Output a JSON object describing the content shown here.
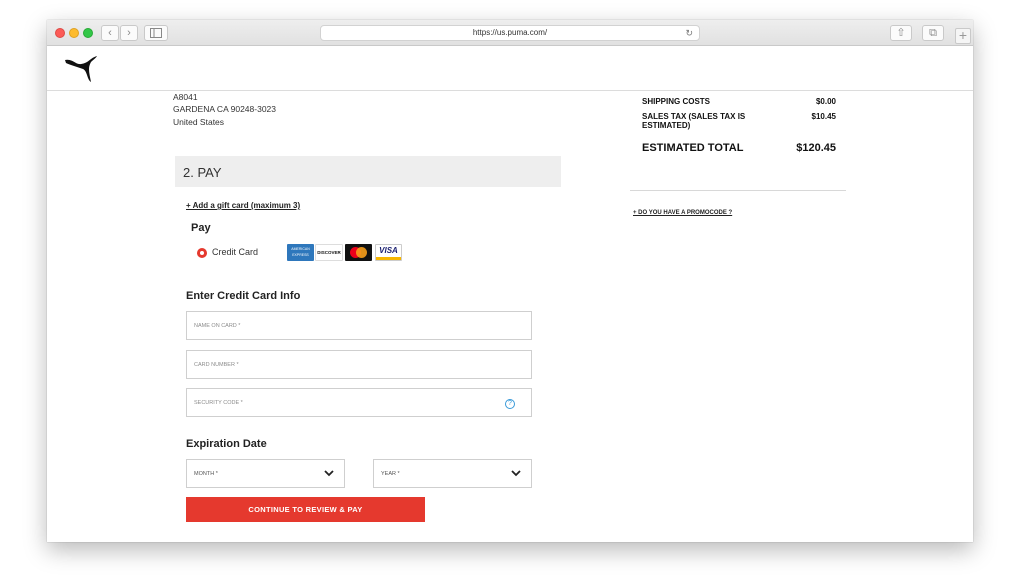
{
  "browser": {
    "url": "https://us.puma.com/",
    "nav_back": "‹",
    "nav_forward": "›",
    "sidebar_icon": "sidebar-icon",
    "reload_icon": "↻",
    "share_icon": "⇧",
    "tabs_icon": "⧉",
    "new_tab_icon": "+"
  },
  "header": {
    "logo": "puma-logo"
  },
  "address": {
    "line1": "A8041",
    "line2": "GARDENA CA 90248-3023",
    "line3": "United States"
  },
  "pay_section": {
    "heading": "2. PAY",
    "gift_card_link": "+ Add a gift card (maximum 3)",
    "pay_label": "Pay",
    "payment_method": "Credit Card",
    "card_logos": {
      "amex": "AMERICAN EXPRESS",
      "discover": "DISCOVER",
      "mastercard": "mastercard",
      "visa": "VISA"
    },
    "card_info_title": "Enter Credit Card Info",
    "fields": {
      "name": "NAME ON CARD *",
      "number": "CARD NUMBER *",
      "security": "SECURITY CODE *"
    },
    "help_icon": "?",
    "expiration_title": "Expiration Date",
    "month_placeholder": "MONTH *",
    "year_placeholder": "YEAR *",
    "continue_button": "CONTINUE TO REVIEW & PAY"
  },
  "summary": {
    "shipping_label": "SHIPPING COSTS",
    "shipping_value": "$0.00",
    "tax_label": "SALES TAX (SALES TAX IS ESTIMATED)",
    "tax_value": "$10.45",
    "total_label": "ESTIMATED TOTAL",
    "total_value": "$120.45",
    "promo_link": "+ DO YOU HAVE A PROMOCODE ?"
  },
  "colors": {
    "accent": "#e5392e",
    "section_bg": "#eeeeee"
  }
}
